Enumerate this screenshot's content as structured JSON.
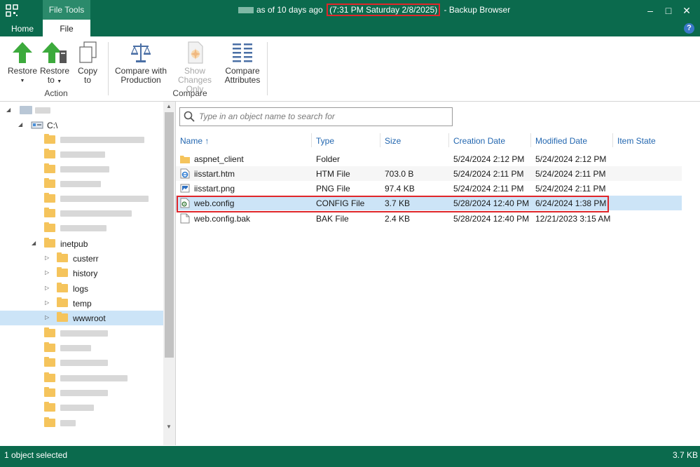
{
  "window": {
    "context_tab": "File Tools",
    "title_prefix": "as of 10 days ago",
    "title_date": "(7:31 PM Saturday 2/8/2025)",
    "title_suffix": "- Backup Browser",
    "minimize": "–",
    "maximize": "□",
    "close": "✕"
  },
  "tabs": {
    "home": "Home",
    "file": "File",
    "help": "?"
  },
  "ribbon": {
    "restore": "Restore",
    "restore_to_1": "Restore",
    "restore_to_2": "to",
    "copy_to_1": "Copy",
    "copy_to_2": "to",
    "compare_prod_1": "Compare with",
    "compare_prod_2": "Production",
    "show_changes_1": "Show",
    "show_changes_2": "Changes Only",
    "compare_attr_1": "Compare",
    "compare_attr_2": "Attributes",
    "group_action": "Action",
    "group_compare": "Compare"
  },
  "tree": {
    "drive": "C:\\",
    "inetpub": "inetpub",
    "children": [
      "custerr",
      "history",
      "logs",
      "temp",
      "wwwroot"
    ]
  },
  "search": {
    "placeholder": "Type in an object name to search for"
  },
  "columns": {
    "name": "Name",
    "sort": "↑",
    "type": "Type",
    "size": "Size",
    "created": "Creation Date",
    "modified": "Modified Date",
    "state": "Item State"
  },
  "files": [
    {
      "name": "aspnet_client",
      "type": "Folder",
      "size": "",
      "created": "5/24/2024 2:12 PM",
      "modified": "5/24/2024 2:12 PM",
      "icon": "folder-icon"
    },
    {
      "name": "iisstart.htm",
      "type": "HTM File",
      "size": "703.0 B",
      "created": "5/24/2024 2:11 PM",
      "modified": "5/24/2024 2:11 PM",
      "icon": "html-file-icon"
    },
    {
      "name": "iisstart.png",
      "type": "PNG File",
      "size": "97.4 KB",
      "created": "5/24/2024 2:11 PM",
      "modified": "5/24/2024 2:11 PM",
      "icon": "image-file-icon"
    },
    {
      "name": "web.config",
      "type": "CONFIG File",
      "size": "3.7 KB",
      "created": "5/28/2024 12:40 PM",
      "modified": "6/24/2024 1:38 PM",
      "icon": "config-file-icon"
    },
    {
      "name": "web.config.bak",
      "type": "BAK File",
      "size": "2.4 KB",
      "created": "5/28/2024 12:40 PM",
      "modified": "12/21/2023 3:15 AM",
      "icon": "file-icon"
    }
  ],
  "status": {
    "left": "1 object selected",
    "right": "3.7 KB"
  },
  "colors": {
    "accent": "#0b6a4d",
    "selection": "#cce4f7",
    "highlight": "#e0262a",
    "link": "#2367b0"
  }
}
